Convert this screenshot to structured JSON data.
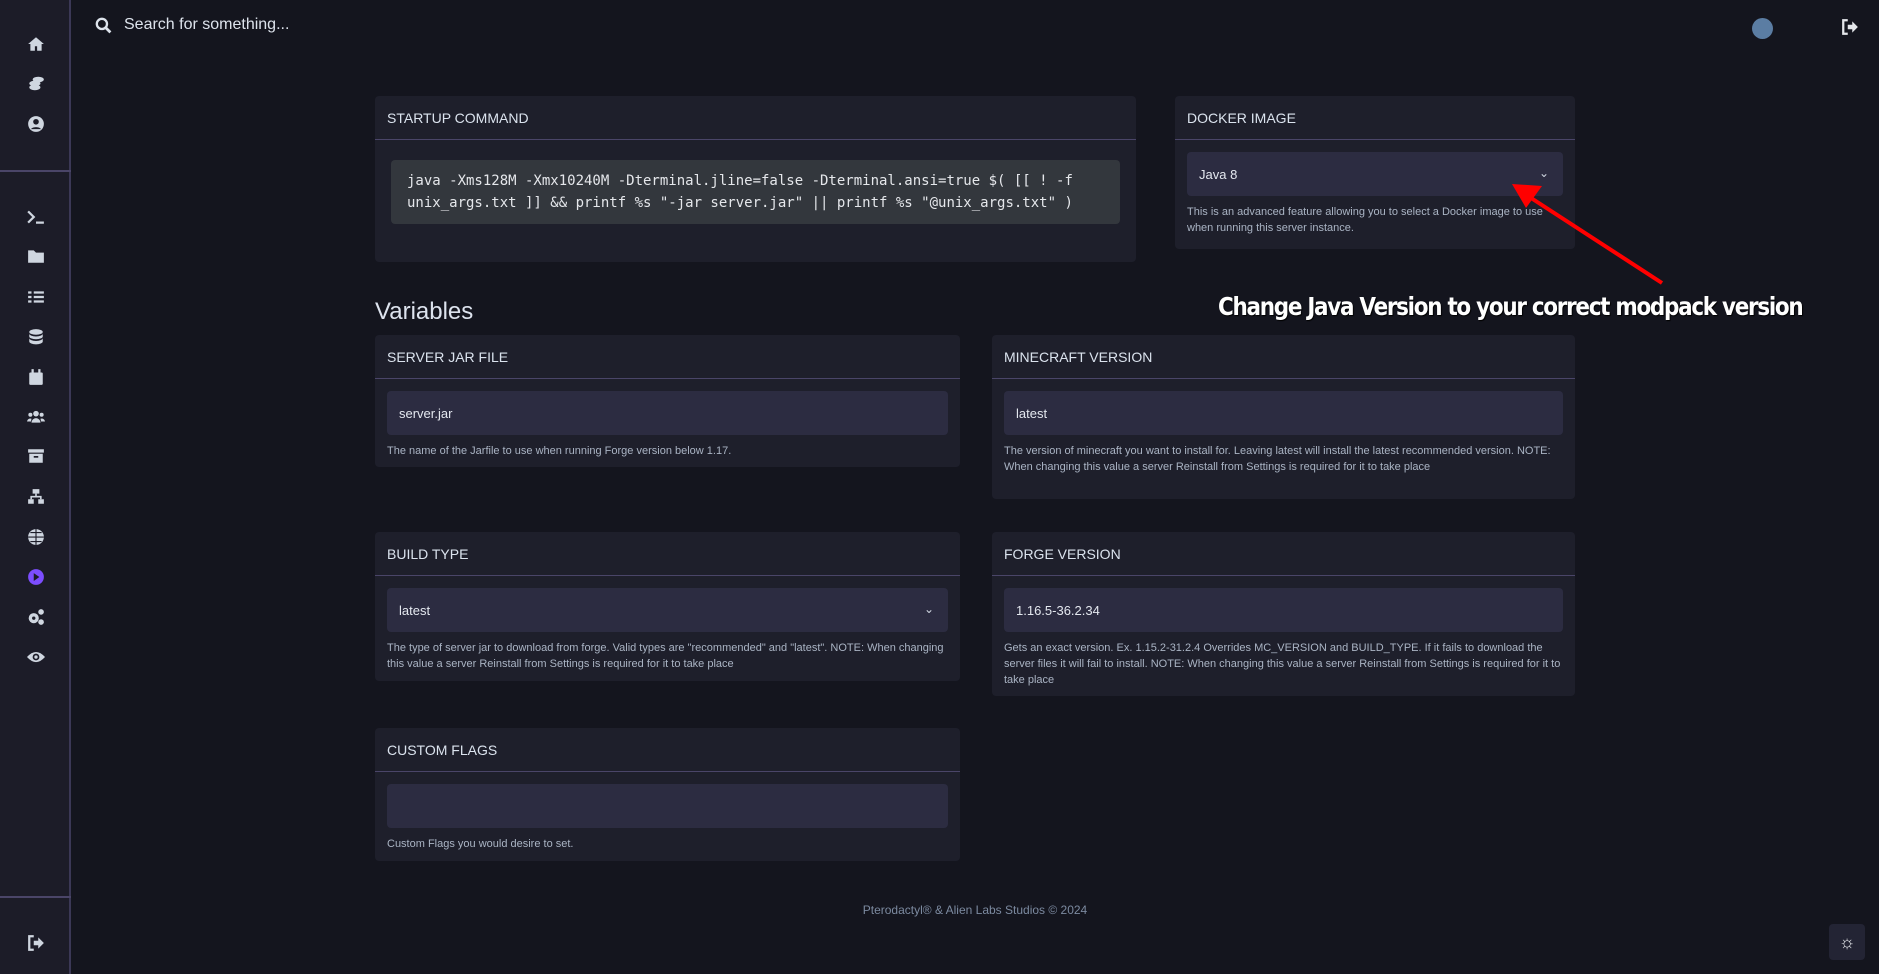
{
  "sidebar": {
    "top_items": [
      {
        "icon": "home-icon"
      },
      {
        "icon": "coins-icon"
      },
      {
        "icon": "user-circle-icon"
      }
    ],
    "server_items": [
      {
        "icon": "terminal-icon"
      },
      {
        "icon": "folder-icon"
      },
      {
        "icon": "tasks-icon"
      },
      {
        "icon": "database-icon"
      },
      {
        "icon": "calendar-icon"
      },
      {
        "icon": "users-icon"
      },
      {
        "icon": "archive-icon"
      },
      {
        "icon": "network-icon"
      },
      {
        "icon": "globe-icon"
      },
      {
        "icon": "play-circle-icon",
        "active": true
      },
      {
        "icon": "cogs-icon"
      },
      {
        "icon": "eye-icon"
      }
    ],
    "bottom_items": [
      {
        "icon": "sign-out-icon"
      }
    ],
    "accent": "#7c4dff"
  },
  "topbar": {
    "search_placeholder": "Search for something..."
  },
  "startup": {
    "title": "Startup Command",
    "command": "java -Xms128M -Xmx10240M -Dterminal.jline=false -Dterminal.ansi=true $( [[ ! -f unix_args.txt ]] && printf %s \"-jar server.jar\" || printf %s \"@unix_args.txt\" )"
  },
  "docker": {
    "title": "Docker Image",
    "value": "Java 8",
    "description": "This is an advanced feature allowing you to select a Docker image to use when running this server instance."
  },
  "variables": {
    "heading": "Variables",
    "items": [
      {
        "title": "Server Jar File",
        "value": "server.jar",
        "description": "The name of the Jarfile to use when running Forge version below 1.17.",
        "type": "text"
      },
      {
        "title": "Minecraft Version",
        "value": "latest",
        "description": "The version of minecraft you want to install for. Leaving latest will install the latest recommended version. NOTE: When changing this value a server Reinstall from Settings is required for it to take place",
        "type": "text"
      },
      {
        "title": "Build Type",
        "value": "latest",
        "description": "The type of server jar to download from forge. Valid types are \"recommended\" and \"latest\". NOTE: When changing this value a server Reinstall from Settings is required for it to take place",
        "type": "select"
      },
      {
        "title": "Forge Version",
        "value": "1.16.5-36.2.34",
        "description": "Gets an exact version. Ex. 1.15.2-31.2.4 Overrides MC_VERSION and BUILD_TYPE. If it fails to download the server files it will fail to install. NOTE: When changing this value a server Reinstall from Settings is required for it to take place",
        "type": "text"
      },
      {
        "title": "Custom Flags",
        "value": "",
        "description": "Custom Flags you would desire to set.",
        "type": "text"
      }
    ]
  },
  "annotation": {
    "text": "Change Java Version to your correct modpack version",
    "color": "#ff0000"
  },
  "footer": {
    "text": "Pterodactyl® & Alien Labs Studios © 2024"
  }
}
